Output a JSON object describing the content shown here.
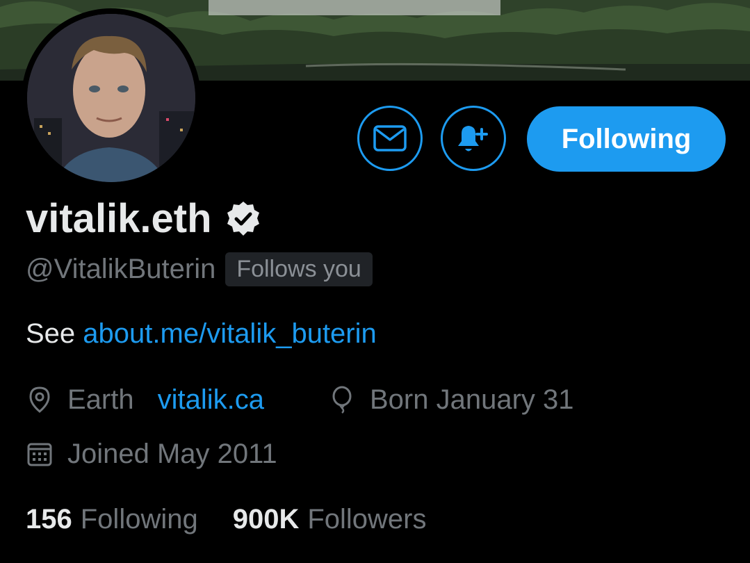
{
  "profile": {
    "display_name": "vitalik.eth",
    "handle": "@VitalikButerin",
    "follows_you": "Follows you",
    "bio_prefix": "See ",
    "bio_link": "about.me/vitalik_buterin",
    "location": "Earth",
    "website": "vitalik.ca",
    "birthday": "Born January 31",
    "joined": "Joined May 2011"
  },
  "actions": {
    "message_icon": "envelope-icon",
    "notify_icon": "bell-plus-icon",
    "follow_label": "Following"
  },
  "stats": {
    "following_count": "156",
    "following_label": "Following",
    "followers_count": "900K",
    "followers_label": "Followers"
  },
  "icons": {
    "verified": "verified-badge-icon",
    "location": "location-pin-icon",
    "birthday": "balloon-icon",
    "joined": "calendar-icon"
  },
  "colors": {
    "accent": "#1d9bf0",
    "background": "#000000",
    "text_primary": "#e7e9ea",
    "text_secondary": "#71767b"
  }
}
